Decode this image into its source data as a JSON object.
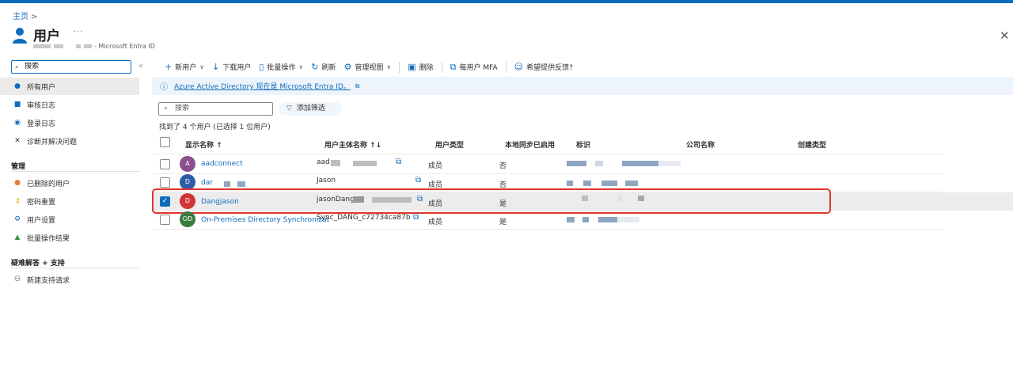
{
  "breadcrumb": {
    "home": "主页",
    "separator": ">"
  },
  "header": {
    "title": "用户",
    "more": "···",
    "subtitle": "- Microsoft Entra ID",
    "close": "✕"
  },
  "sidebar": {
    "search_value": "搜索",
    "collapse": "«",
    "items": [
      {
        "label": "所有用户",
        "icon": "user-icon"
      },
      {
        "label": "审核日志",
        "icon": "audit-log-icon"
      },
      {
        "label": "登录日志",
        "icon": "signin-log-icon"
      },
      {
        "label": "诊断并解决问题",
        "icon": "wrench-icon"
      }
    ],
    "section_manage": "管理",
    "manage_items": [
      {
        "label": "已删除的用户",
        "icon": "deleted-user-icon"
      },
      {
        "label": "密码重置",
        "icon": "key-icon"
      },
      {
        "label": "用户设置",
        "icon": "user-settings-icon"
      },
      {
        "label": "批量操作结果",
        "icon": "bulk-results-icon"
      }
    ],
    "section_support": "疑难解答 + 支持",
    "support_items": [
      {
        "label": "新建支持请求",
        "icon": "support-request-icon"
      }
    ]
  },
  "toolbar": {
    "new_user": "新用户",
    "download_users": "下载用户",
    "bulk_ops": "批量操作",
    "refresh": "刷新",
    "manage_view": "管理视图",
    "delete": "删除",
    "per_user_mfa": "每用户 MFA",
    "feedback": "希望提供反馈?"
  },
  "banner": {
    "text": "Azure Active Directory 现在是 Microsoft Entra ID。",
    "external": "⧉"
  },
  "filter": {
    "search_placeholder": "搜索",
    "add_filter": "添加筛选",
    "count_text": "找到了 4 个用户 (已选择 1 位用户)"
  },
  "table": {
    "columns": [
      "显示名称 ↑",
      "用户主体名称 ↑↓",
      "用户类型",
      "本地同步已启用",
      "标识",
      "公司名称",
      "创建类型"
    ],
    "rows": [
      {
        "initials": "A",
        "avatar_color": "#8b4f8f",
        "name": "aadconnect",
        "upn": "aad",
        "type": "成员",
        "sync": "否",
        "selected": false
      },
      {
        "initials": "D",
        "avatar_color": "#2e5da8",
        "name": "dar",
        "upn": "Jason",
        "type": "成员",
        "sync": "否",
        "selected": false
      },
      {
        "initials": "D",
        "avatar_color": "#d13438",
        "name": "Dangjason",
        "upn": "jasonDang",
        "type": "成员",
        "sync": "是",
        "selected": true
      },
      {
        "initials": "OD",
        "avatar_color": "#3b7a3f",
        "name": "On-Premises Directory Synchronizat",
        "upn": "Sync_DANG_c72734ca87b...",
        "type": "成员",
        "sync": "是",
        "selected": false
      }
    ]
  }
}
